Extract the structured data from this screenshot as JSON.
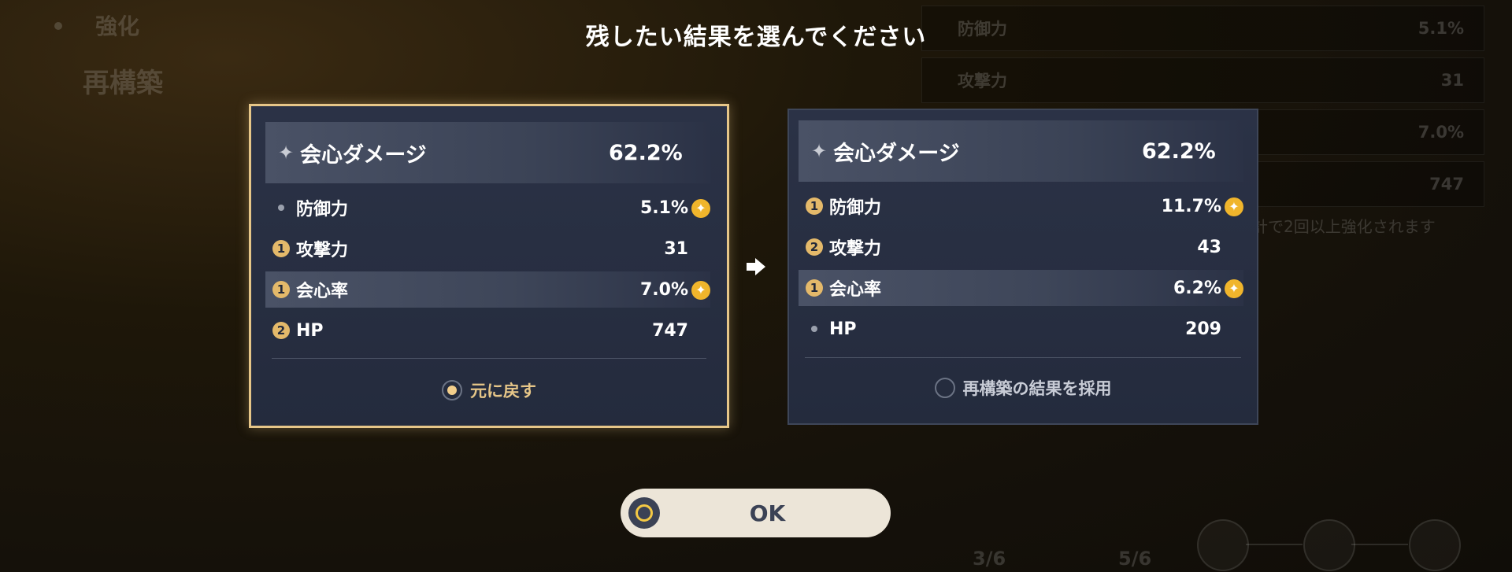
{
  "title": "残したい結果を選んでください",
  "background": {
    "enhance_label": "強化",
    "reconstruct_label": "再構築",
    "right_rows": [
      {
        "name": "防御力",
        "value": "5.1%"
      },
      {
        "name": "攻撃力",
        "value": "31"
      },
      {
        "name": "",
        "value": "7.0%"
      },
      {
        "name": "HP",
        "value": "747"
      }
    ],
    "note": "サブステータスを強化時、同じ指定の項目合計で2回以上強化されます",
    "count_before": "3/6",
    "count_after": "5/6"
  },
  "left_card": {
    "main_stat": {
      "name": "会心ダメージ",
      "value": "62.2%"
    },
    "substats": [
      {
        "marker": "",
        "name": "防御力",
        "value": "5.1%",
        "spark": true,
        "highlight": false
      },
      {
        "marker": "1",
        "name": "攻撃力",
        "value": "31",
        "spark": false,
        "highlight": false
      },
      {
        "marker": "1",
        "name": "会心率",
        "value": "7.0%",
        "spark": true,
        "highlight": true
      },
      {
        "marker": "2",
        "name": "HP",
        "value": "747",
        "spark": false,
        "highlight": false
      }
    ],
    "option_label": "元に戻す",
    "selected": true
  },
  "right_card": {
    "main_stat": {
      "name": "会心ダメージ",
      "value": "62.2%"
    },
    "substats": [
      {
        "marker": "1",
        "name": "防御力",
        "value": "11.7%",
        "spark": true,
        "highlight": false
      },
      {
        "marker": "2",
        "name": "攻撃力",
        "value": "43",
        "spark": false,
        "highlight": false
      },
      {
        "marker": "1",
        "name": "会心率",
        "value": "6.2%",
        "spark": true,
        "highlight": true
      },
      {
        "marker": "",
        "name": "HP",
        "value": "209",
        "spark": false,
        "highlight": false
      }
    ],
    "option_label": "再構築の結果を採用",
    "selected": false
  },
  "ok_label": "OK",
  "colors": {
    "gold": "#e6c688",
    "spark": "#f0b52c",
    "card_bg": "#242b3d"
  }
}
